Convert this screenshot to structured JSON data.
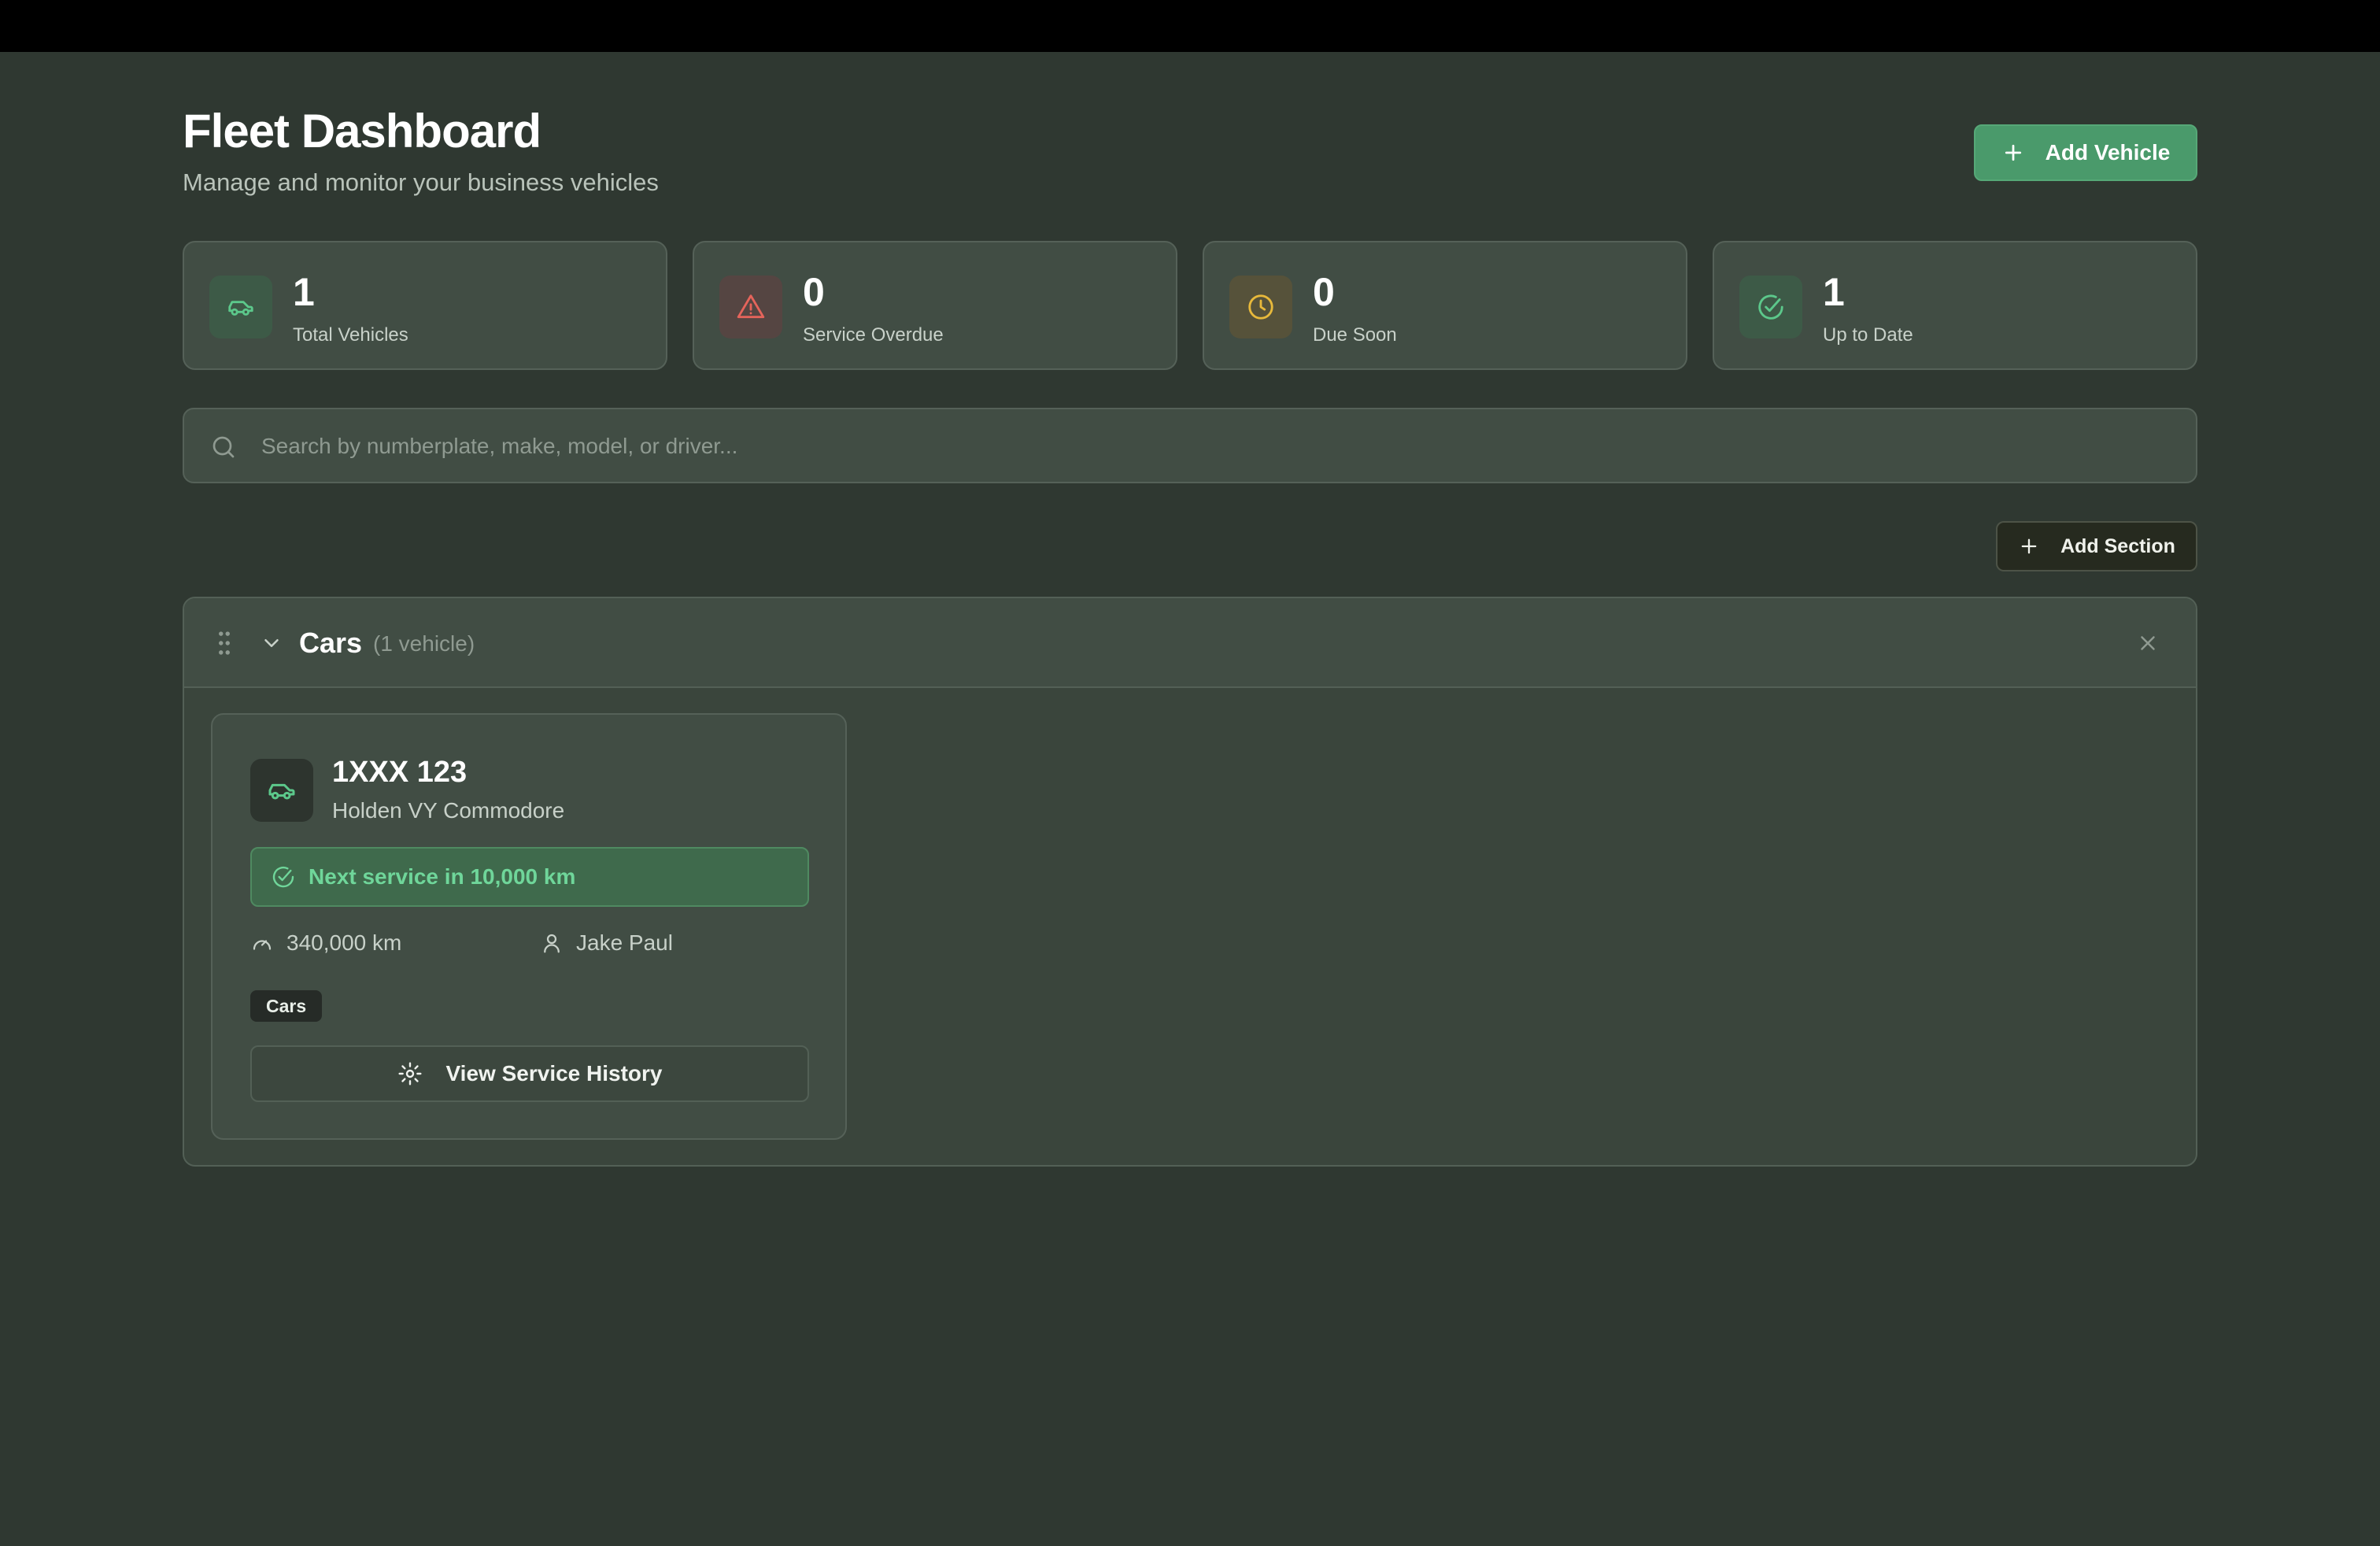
{
  "header": {
    "title": "Fleet Dashboard",
    "subtitle": "Manage and monitor your business vehicles",
    "add_vehicle_label": "Add Vehicle"
  },
  "stats": [
    {
      "value": "1",
      "label": "Total Vehicles",
      "icon": "car-icon",
      "color": "#5cc88b"
    },
    {
      "value": "0",
      "label": "Service Overdue",
      "icon": "warning-triangle-icon",
      "color": "#e5645b"
    },
    {
      "value": "0",
      "label": "Due Soon",
      "icon": "clock-icon",
      "color": "#e8b93b"
    },
    {
      "value": "1",
      "label": "Up to Date",
      "icon": "check-circle-icon",
      "color": "#5cc88b"
    }
  ],
  "search": {
    "placeholder": "Search by numberplate, make, model, or driver...",
    "value": ""
  },
  "add_section_label": "Add Section",
  "section": {
    "name": "Cars",
    "count_label": "(1 vehicle)",
    "vehicles": [
      {
        "plate": "1XXX 123",
        "model": "Holden VY Commodore",
        "service_status": "Next service in 10,000 km",
        "odometer": "340,000 km",
        "driver": "Jake Paul",
        "tag": "Cars",
        "history_label": "View Service History"
      }
    ]
  },
  "colors": {
    "background": "#2f3831",
    "card": "#414d44",
    "accent": "#4a9a6b",
    "success_text": "#6fd69a"
  }
}
